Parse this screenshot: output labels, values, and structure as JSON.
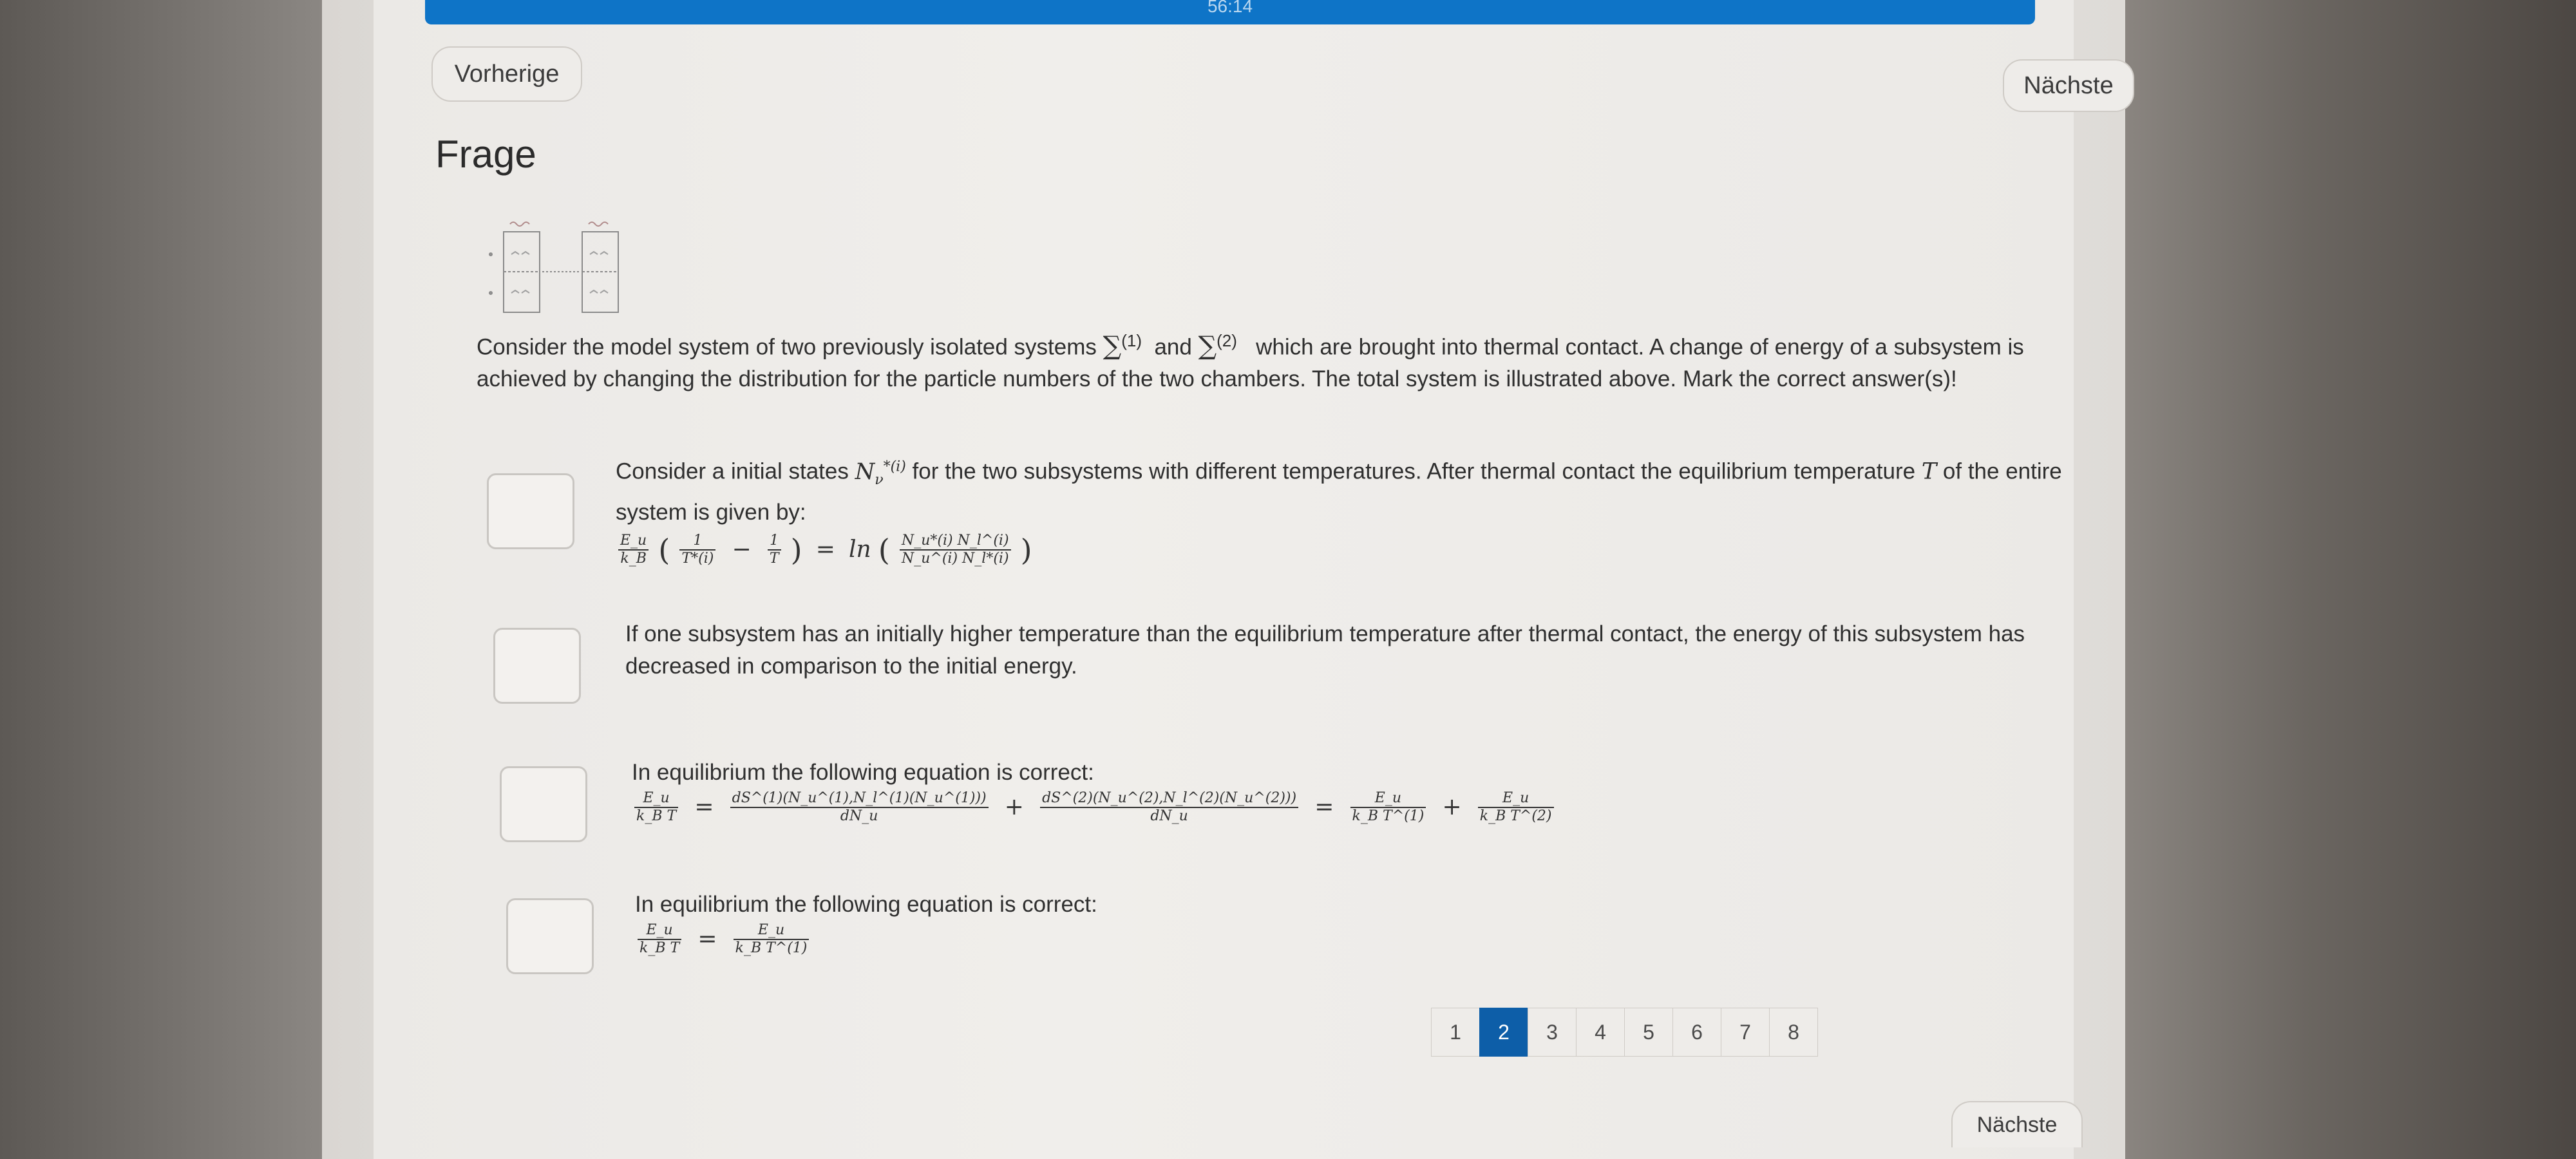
{
  "timer": "56:14",
  "nav": {
    "prev_label": "Vorherige",
    "next_label": "Nächste",
    "next_bottom_label": "Nächste"
  },
  "heading": "Frage",
  "question": {
    "part1": "Consider the model system of two previously isolated systems",
    "sigma1_sup": "(1)",
    "and": "and",
    "sigma2_sup": "(2)",
    "part2": "which are brought into thermal contact. A change of energy of a subsystem is achieved by changing the distribution for the particle numbers of the two chambers. The total system is illustrated above. Mark the correct answer(s)!"
  },
  "options": [
    {
      "text_before": "Consider a initial states",
      "symbol": "N",
      "symbol_sub": "ν",
      "symbol_sup": "*(i)",
      "text_middle": "for the two subsystems with different temperatures. After thermal contact the equilibrium temperature",
      "temp_symbol": "T",
      "text_after": "of the entire system is given by:",
      "formula": {
        "lhs_num": "E_u",
        "lhs_den": "k_B",
        "t1_num": "1",
        "t1_den": "T*(i)",
        "t2_num": "1",
        "t2_den": "T",
        "ln": "ln",
        "rhs_num": "N_u*(i) N_l^(i)",
        "rhs_den": "N_u^(i) N_l*(i)"
      }
    },
    {
      "text": "If one subsystem has an initially higher temperature than the equilibrium temperature after thermal contact, the energy of this subsystem has decreased in comparison to the initial energy."
    },
    {
      "text": "In equilibrium the following equation is correct:",
      "formula": {
        "a_num": "E_u",
        "a_den": "k_B T",
        "b_num": "dS^(1)(N_u^(1),N_l^(1)(N_u^(1)))",
        "b_den": "dN_u",
        "c_num": "dS^(2)(N_u^(2),N_l^(2)(N_u^(2)))",
        "c_den": "dN_u",
        "d_num": "E_u",
        "d_den": "k_B T^(1)",
        "e_num": "E_u",
        "e_den": "k_B T^(2)"
      }
    },
    {
      "text": "In equilibrium the following equation is correct:",
      "formula": {
        "a_num": "E_u",
        "a_den": "k_B T",
        "b_num": "E_u",
        "b_den": "k_B T^(1)"
      }
    }
  ],
  "pagination": {
    "pages": [
      "1",
      "2",
      "3",
      "4",
      "5",
      "6",
      "7",
      "8"
    ],
    "current": "2"
  },
  "colors": {
    "accent": "#0d5ea8",
    "timer_bar": "#0e74c7"
  }
}
